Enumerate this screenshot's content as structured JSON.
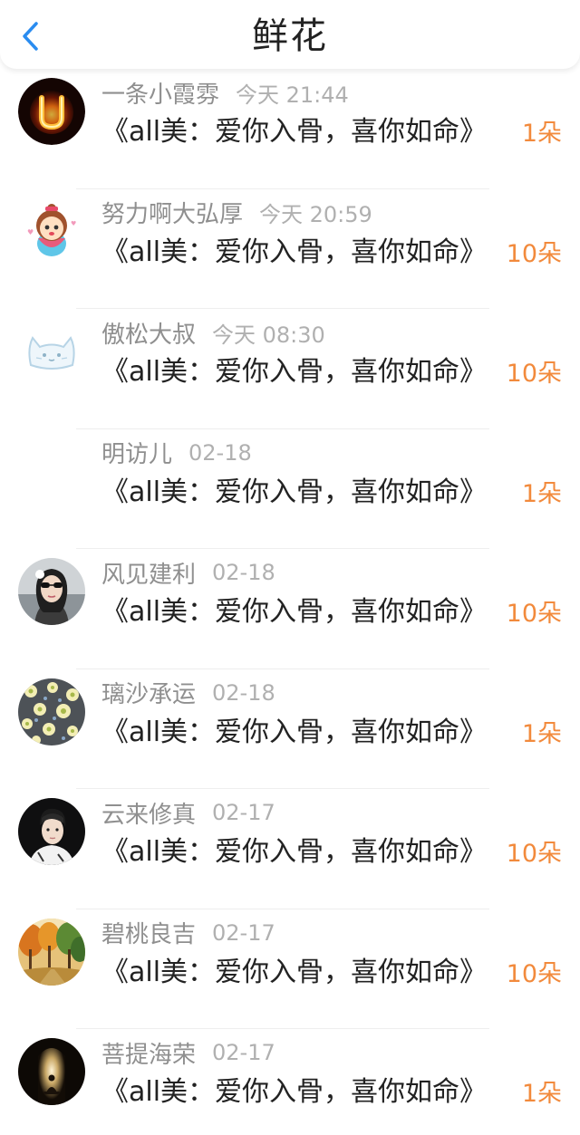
{
  "header": {
    "title": "鲜花"
  },
  "colors": {
    "accent_blue": "#2a8cf0",
    "count_orange": "#f28a3c",
    "name_gray": "#8f8f8f",
    "time_gray": "#b0b0b0",
    "text_dark": "#222222"
  },
  "records": [
    {
      "name": "一条小霞雰",
      "time": "今天 21:44",
      "book": "《all美：爱你入骨，喜你如命》",
      "count": "1朵",
      "avatar_icon": "flaming-letter-u-avatar"
    },
    {
      "name": "努力啊大弘厚",
      "time": "今天 20:59",
      "book": "《all美：爱你入骨，喜你如命》",
      "count": "10朵",
      "avatar_icon": "cartoon-girl-avatar"
    },
    {
      "name": "傲松大叔",
      "time": "今天 08:30",
      "book": "《all美：爱你入骨，喜你如命》",
      "count": "10朵",
      "avatar_icon": "cat-face-avatar"
    },
    {
      "name": "明访儿",
      "time": "02-18",
      "book": "《all美：爱你入骨，喜你如命》",
      "count": "1朵",
      "avatar_icon": "blank-avatar"
    },
    {
      "name": "风见建利",
      "time": "02-18",
      "book": "《all美：爱你入骨，喜你如命》",
      "count": "10朵",
      "avatar_icon": "woman-sunglasses-photo-avatar"
    },
    {
      "name": "璃沙承运",
      "time": "02-18",
      "book": "《all美：爱你入骨，喜你如命》",
      "count": "1朵",
      "avatar_icon": "floral-pattern-avatar"
    },
    {
      "name": "云来修真",
      "time": "02-17",
      "book": "《all美：爱你入骨，喜你如命》",
      "count": "10朵",
      "avatar_icon": "young-man-photo-avatar"
    },
    {
      "name": "碧桃良吉",
      "time": "02-17",
      "book": "《all美：爱你入骨，喜你如命》",
      "count": "10朵",
      "avatar_icon": "autumn-trees-avatar"
    },
    {
      "name": "菩提海荣",
      "time": "02-17",
      "book": "《all美：爱你入骨，喜你如命》",
      "count": "1朵",
      "avatar_icon": "meditation-light-avatar"
    }
  ]
}
